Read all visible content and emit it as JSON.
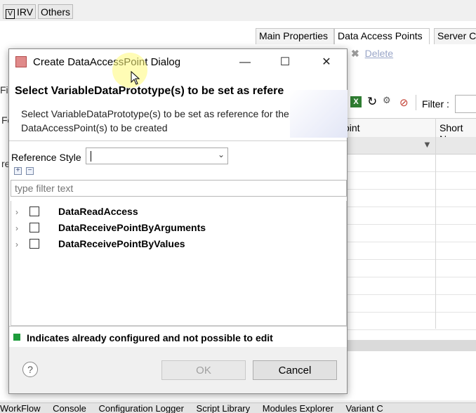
{
  "top_tabs": [
    "IRV",
    "Others"
  ],
  "editor_tabs": [
    "Main Properties",
    "Data Access Points",
    "Server C"
  ],
  "delete_label": "Delete",
  "filter_label": "Filter :",
  "grid_headers": [
    "oint",
    "Short Na"
  ],
  "left_stubs": [
    "Fil",
    "Fe",
    "re"
  ],
  "bottom_tabs": [
    "WorkFlow",
    "Console",
    "Configuration Logger",
    "Script Library",
    "Modules Explorer",
    "Variant C"
  ],
  "dialog": {
    "title": "Create DataAccessPoint Dialog",
    "window_controls": {
      "minimize": "—",
      "maximize": "☐",
      "close": "✕"
    },
    "header_title": "Select VariableDataPrototype(s) to be set as refere",
    "header_description": "Select VariableDataPrototype(s) to be set as reference for the DataAccessPoint(s) to be created",
    "reference_style_label": "Reference Style",
    "reference_style_value": "",
    "expand_all": "+",
    "collapse_all": "−",
    "filter_placeholder": "type filter text",
    "tree_items": [
      "DataReadAccess",
      "DataReceivePointByArguments",
      "DataReceivePointByValues"
    ],
    "legend_text": "Indicates already configured and not possible to edit",
    "legend_color": "#1e9c3c",
    "help_symbol": "?",
    "ok_label": "OK",
    "cancel_label": "Cancel"
  }
}
